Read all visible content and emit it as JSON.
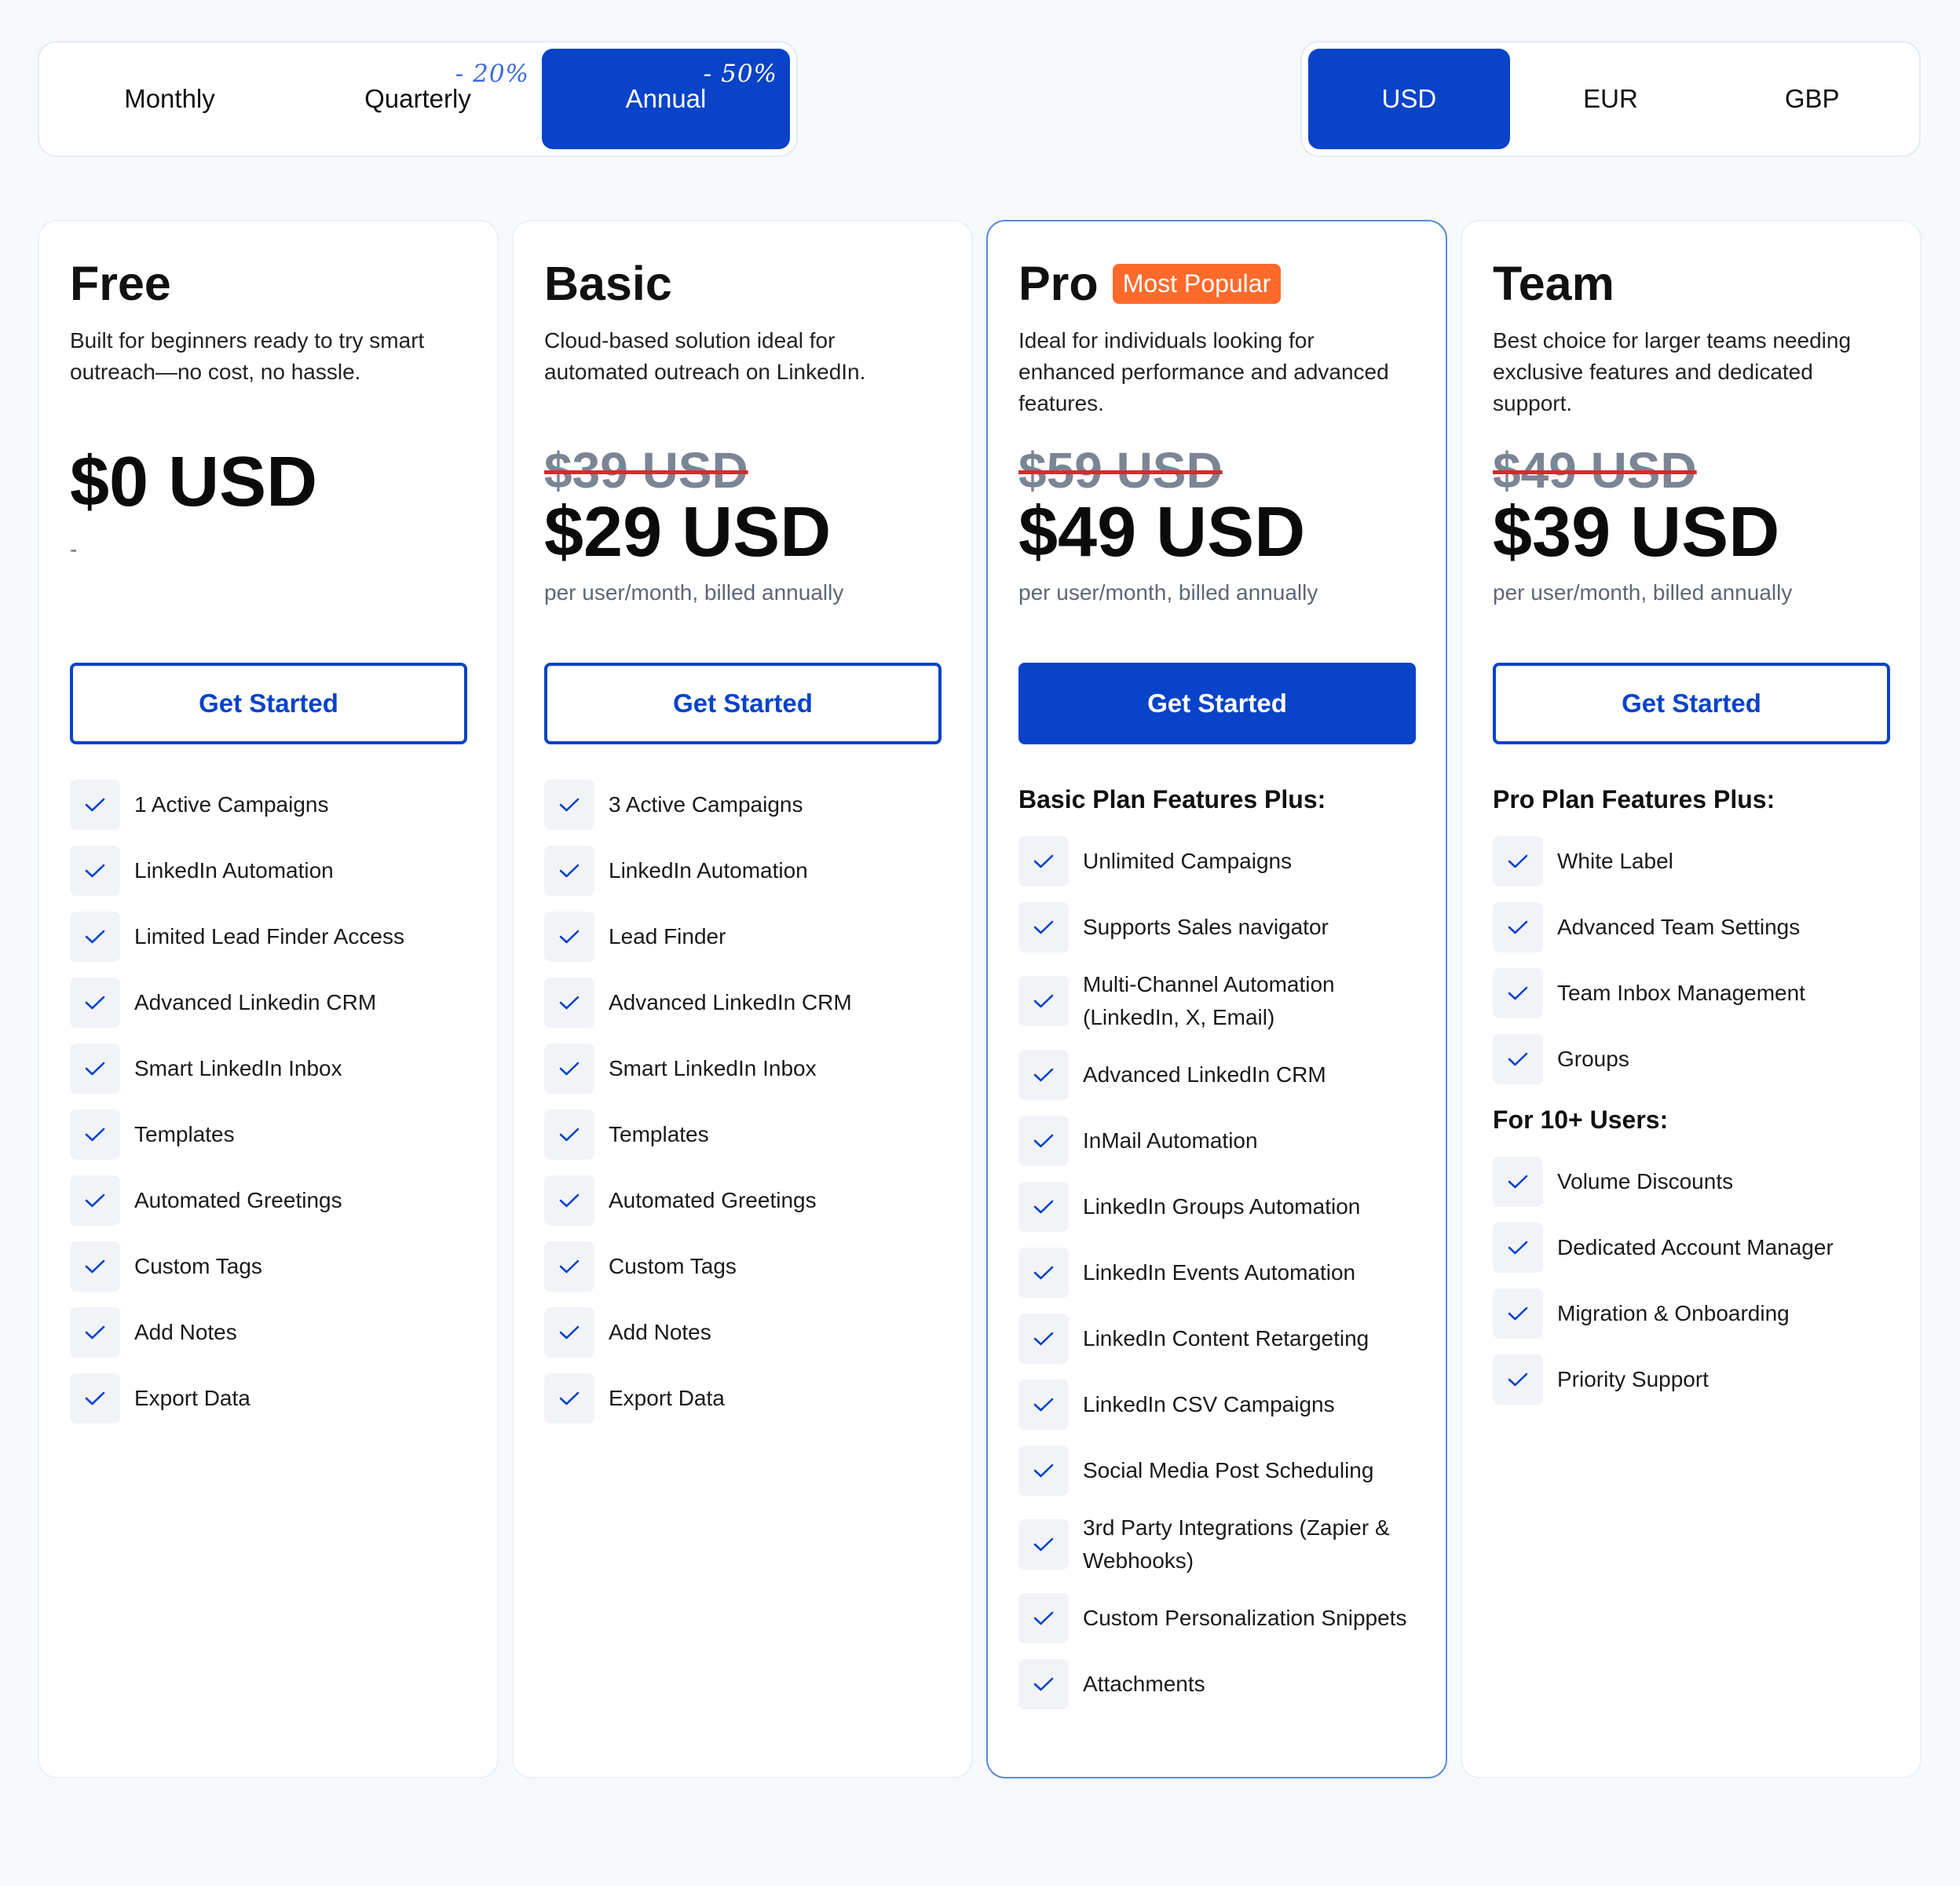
{
  "billing": {
    "options": [
      {
        "label": "Monthly",
        "discount": ""
      },
      {
        "label": "Quarterly",
        "discount": "- 20%"
      },
      {
        "label": "Annual",
        "discount": "- 50%"
      }
    ],
    "selected": "Annual"
  },
  "currency": {
    "options": [
      "USD",
      "EUR",
      "GBP"
    ],
    "selected": "USD"
  },
  "colors": {
    "accent": "#0843c8",
    "badge": "#ff6a2b",
    "strike": "#e0262c"
  },
  "plans": [
    {
      "name": "Free",
      "description": "Built for beginners ready to try smart outreach—no cost, no hassle.",
      "old_price": "",
      "price": "$0 USD",
      "note": "-",
      "cta": "Get Started",
      "features": [
        "1 Active Campaigns",
        "LinkedIn Automation",
        "Limited Lead Finder Access",
        "Advanced Linkedin CRM",
        "Smart LinkedIn Inbox",
        "Templates",
        "Automated Greetings",
        "Custom Tags",
        "Add Notes",
        "Export Data"
      ]
    },
    {
      "name": "Basic",
      "description": "Cloud-based solution ideal for automated outreach on LinkedIn.",
      "old_price": "$39 USD",
      "price": "$29 USD",
      "note": "per user/month, billed annually",
      "cta": "Get Started",
      "features": [
        "3 Active Campaigns",
        "LinkedIn Automation",
        "Lead Finder",
        "Advanced LinkedIn CRM",
        "Smart LinkedIn Inbox",
        "Templates",
        "Automated Greetings",
        "Custom Tags",
        "Add Notes",
        "Export Data"
      ]
    },
    {
      "name": "Pro",
      "badge": "Most Popular",
      "description": "Ideal for individuals looking for enhanced performance and advanced features.",
      "old_price": "$59 USD",
      "price": "$49 USD",
      "note": "per user/month, billed annually",
      "cta": "Get Started",
      "section": "Basic Plan Features Plus:",
      "features": [
        "Unlimited Campaigns",
        "Supports Sales navigator",
        "Multi-Channel Automation (LinkedIn, X, Email)",
        "Advanced LinkedIn CRM",
        "InMail Automation",
        "LinkedIn Groups Automation",
        "LinkedIn Events Automation",
        "LinkedIn Content Retargeting",
        "LinkedIn CSV Campaigns",
        "Social Media Post Scheduling",
        "3rd Party Integrations (Zapier & Webhooks)",
        "Custom Personalization Snippets",
        "Attachments"
      ]
    },
    {
      "name": "Team",
      "description": "Best choice for larger teams needing exclusive features and dedicated support.",
      "old_price": "$49 USD",
      "price": "$39 USD",
      "note": "per user/month, billed annually",
      "cta": "Get Started",
      "section": "Pro Plan Features Plus:",
      "features": [
        "White Label",
        "Advanced Team Settings",
        "Team Inbox Management",
        "Groups"
      ],
      "section2": "For 10+ Users:",
      "features2": [
        "Volume Discounts",
        "Dedicated Account Manager",
        "Migration & Onboarding",
        "Priority Support"
      ]
    }
  ]
}
